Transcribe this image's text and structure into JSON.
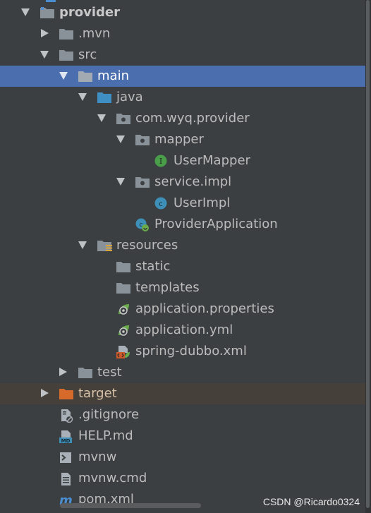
{
  "tree": {
    "nodes": [
      {
        "label": "provider",
        "icon": "module-folder-icon",
        "expanded": true,
        "bold": true
      },
      {
        "label": ".mvn",
        "icon": "folder-icon",
        "expanded": false
      },
      {
        "label": "src",
        "icon": "folder-icon",
        "expanded": true
      },
      {
        "label": "main",
        "icon": "folder-icon",
        "expanded": true,
        "selected": true
      },
      {
        "label": "java",
        "icon": "source-root-icon",
        "expanded": true
      },
      {
        "label": "com.wyq.provider",
        "icon": "package-icon",
        "expanded": true
      },
      {
        "label": "mapper",
        "icon": "package-icon",
        "expanded": true
      },
      {
        "label": "UserMapper",
        "icon": "interface-icon"
      },
      {
        "label": "service.impl",
        "icon": "package-icon",
        "expanded": true
      },
      {
        "label": "UserImpl",
        "icon": "class-icon"
      },
      {
        "label": "ProviderApplication",
        "icon": "spring-boot-class-icon"
      },
      {
        "label": "resources",
        "icon": "resources-folder-icon",
        "expanded": true
      },
      {
        "label": "static",
        "icon": "folder-icon"
      },
      {
        "label": "templates",
        "icon": "folder-icon"
      },
      {
        "label": "application.properties",
        "icon": "spring-config-icon"
      },
      {
        "label": "application.yml",
        "icon": "spring-config-icon"
      },
      {
        "label": "spring-dubbo.xml",
        "icon": "xml-file-icon"
      },
      {
        "label": "test",
        "icon": "folder-icon",
        "expanded": false
      },
      {
        "label": "target",
        "icon": "excluded-folder-icon",
        "expanded": false,
        "excluded": true
      },
      {
        "label": ".gitignore",
        "icon": "gitignore-file-icon"
      },
      {
        "label": "HELP.md",
        "icon": "markdown-file-icon"
      },
      {
        "label": "mvnw",
        "icon": "shell-script-icon"
      },
      {
        "label": "mvnw.cmd",
        "icon": "text-file-icon"
      },
      {
        "label": "pom.xml",
        "icon": "maven-icon"
      }
    ]
  },
  "watermark": "CSDN @Ricardo0324",
  "colors": {
    "background": "#3c3f41",
    "selection": "#4b6eaf",
    "excluded_row": "#45403a",
    "folder": "#8a9299",
    "source_root": "#3f8fc4",
    "excluded_folder": "#d56a2b",
    "interface_badge": "#4a9e4a",
    "class_badge": "#3d8fb8",
    "spring_green": "#6aab4c"
  }
}
